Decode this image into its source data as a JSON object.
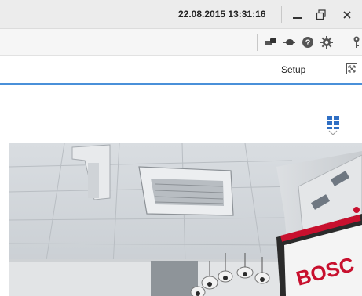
{
  "titlebar": {
    "datetime": "22.08.2015 13:31:16",
    "minimize_icon": "minimize-icon",
    "restore_icon": "restore-icon",
    "close_icon": "close-icon"
  },
  "toolbar": {
    "icons": [
      "connection-icon",
      "network-icon",
      "help-icon",
      "settings-icon",
      "key-icon"
    ]
  },
  "nav": {
    "setup_label": "Setup",
    "fullscreen_icon": "fullscreen-icon"
  },
  "main": {
    "layout_icon": "layout-grid-icon",
    "camera_view": {
      "brand_text": "BOSC"
    }
  },
  "colors": {
    "accent": "#4a90d9",
    "layout_icon": "#2f6fc4",
    "brand_red": "#c8102e"
  }
}
